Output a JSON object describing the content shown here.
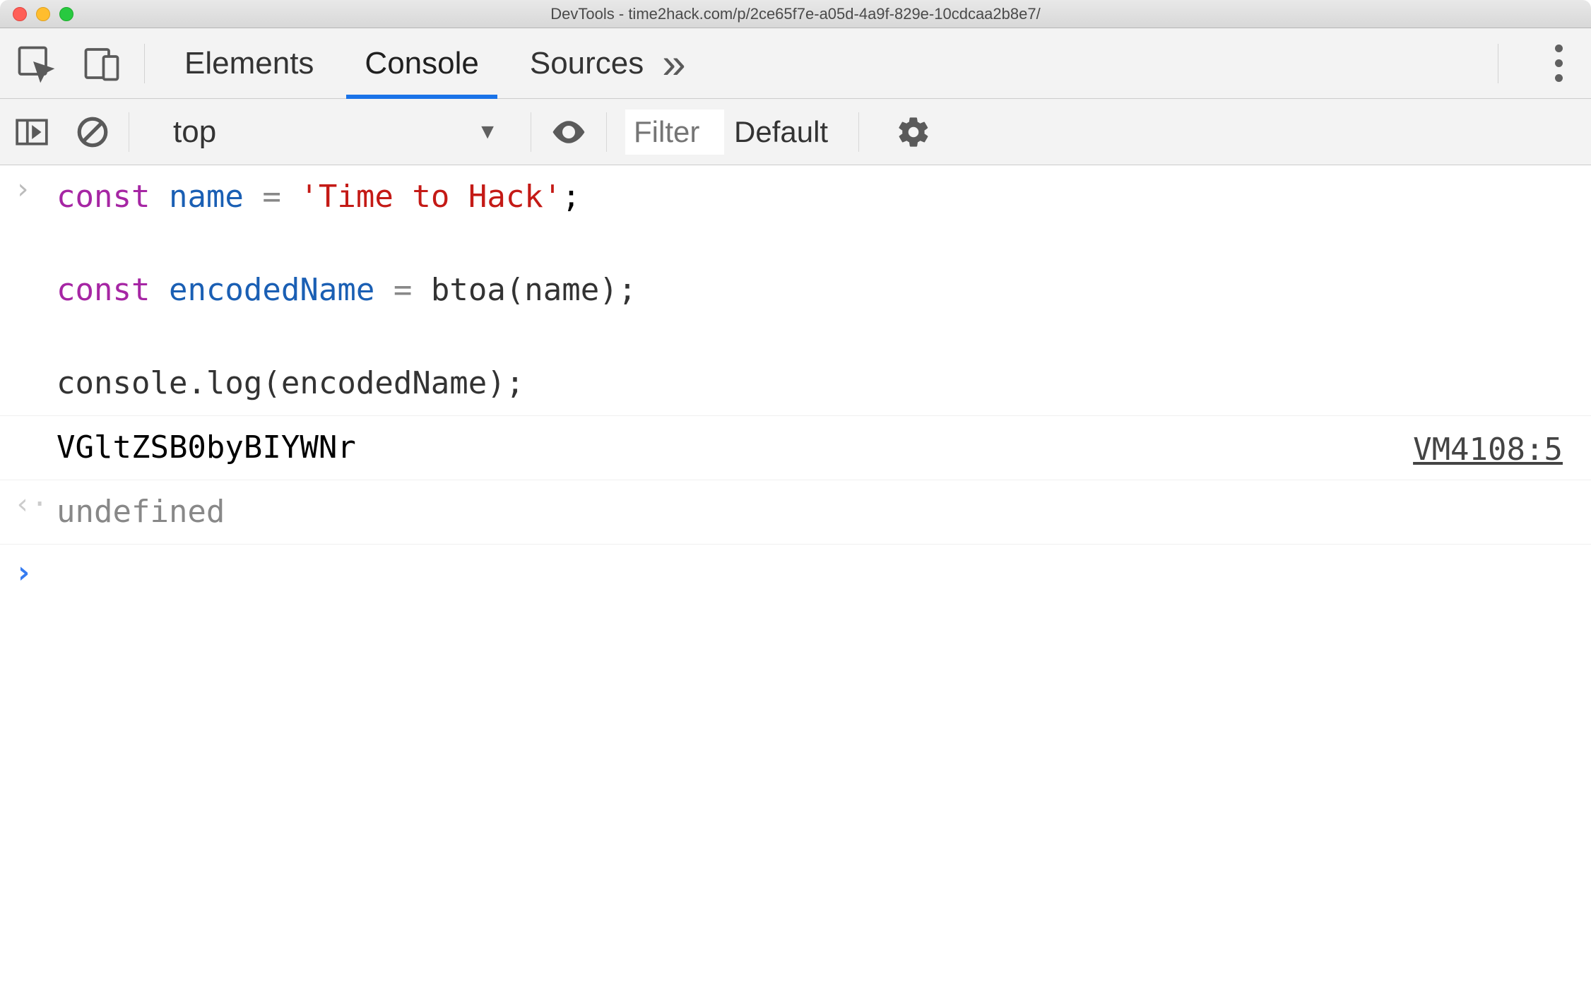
{
  "window": {
    "title": "DevTools - time2hack.com/p/2ce65f7e-a05d-4a9f-829e-10cdcaa2b8e7/"
  },
  "tabs": {
    "elements": "Elements",
    "console": "Console",
    "sources": "Sources"
  },
  "subtoolbar": {
    "context": "top",
    "filter_placeholder": "Filter",
    "levels": "Default"
  },
  "console": {
    "code_line1_kw": "const",
    "code_line1_var": "name",
    "code_line1_op": "=",
    "code_line1_str": "'Time to Hack'",
    "code_line1_semi": ";",
    "code_line3_kw": "const",
    "code_line3_var": "encodedName",
    "code_line3_op": "=",
    "code_line3_fn": "btoa(name);",
    "code_line5": "console.log(encodedName);",
    "log_output": "VGltZSB0byBIYWNr",
    "log_source": "VM4108:5",
    "return_value": "undefined"
  }
}
